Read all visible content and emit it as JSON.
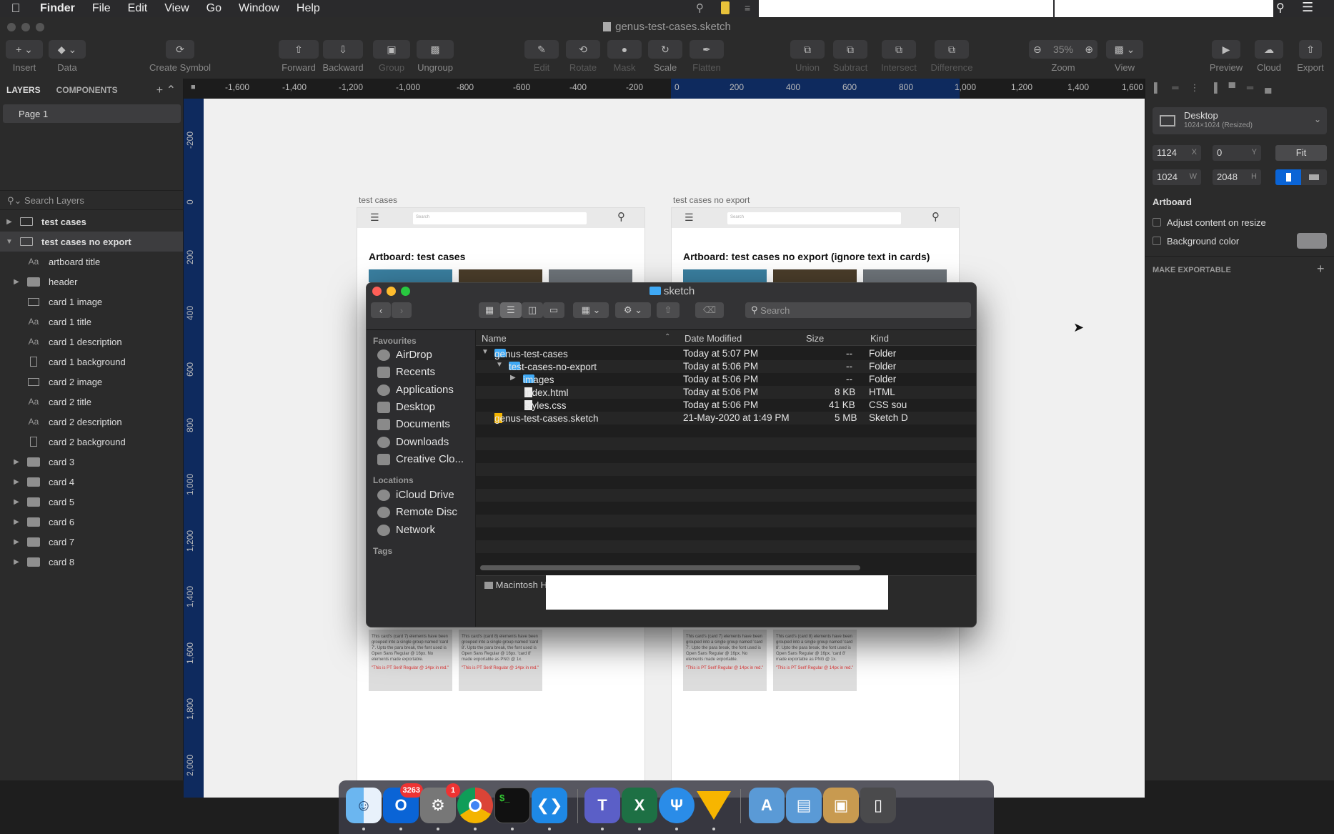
{
  "menubar": {
    "app": "Finder",
    "items": [
      "File",
      "Edit",
      "View",
      "Go",
      "Window",
      "Help"
    ]
  },
  "window": {
    "title": "genus-test-cases.sketch"
  },
  "toolbar": {
    "insert": "Insert",
    "data": "Data",
    "create_symbol": "Create Symbol",
    "forward": "Forward",
    "backward": "Backward",
    "group": "Group",
    "ungroup": "Ungroup",
    "edit": "Edit",
    "rotate": "Rotate",
    "mask": "Mask",
    "scale": "Scale",
    "flatten": "Flatten",
    "union": "Union",
    "subtract": "Subtract",
    "intersect": "Intersect",
    "difference": "Difference",
    "zoom": "Zoom",
    "zoom_value": "35%",
    "view": "View",
    "preview": "Preview",
    "cloud": "Cloud",
    "export": "Export"
  },
  "layers_panel": {
    "tab_layers": "LAYERS",
    "tab_components": "COMPONENTS",
    "page": "Page 1",
    "search_placeholder": "Search Layers",
    "items": [
      {
        "label": "test cases",
        "icon": "artboard-icon"
      },
      {
        "label": "test cases no export",
        "icon": "artboard-icon"
      },
      {
        "label": "artboard title",
        "icon": "text-icon"
      },
      {
        "label": "header",
        "icon": "folder-icon"
      },
      {
        "label": "card 1 image",
        "icon": "rectangle-icon"
      },
      {
        "label": "card 1 title",
        "icon": "text-icon"
      },
      {
        "label": "card 1 description",
        "icon": "text-icon"
      },
      {
        "label": "card 1 background",
        "icon": "rectangle-icon"
      },
      {
        "label": "card 2 image",
        "icon": "rectangle-icon"
      },
      {
        "label": "card 2 title",
        "icon": "text-icon"
      },
      {
        "label": "card 2 description",
        "icon": "text-icon"
      },
      {
        "label": "card 2 background",
        "icon": "rectangle-icon"
      },
      {
        "label": "card 3",
        "icon": "folder-icon"
      },
      {
        "label": "card 4",
        "icon": "folder-icon"
      },
      {
        "label": "card 5",
        "icon": "folder-icon"
      },
      {
        "label": "card 6",
        "icon": "folder-icon"
      },
      {
        "label": "card 7",
        "icon": "folder-icon"
      },
      {
        "label": "card 8",
        "icon": "folder-icon"
      }
    ]
  },
  "ruler": {
    "top": [
      "-1,600",
      "-1,400",
      "-1,200",
      "-1,000",
      "-800",
      "-600",
      "-400",
      "-200",
      "0",
      "200",
      "400",
      "600",
      "800",
      "1,000",
      "1,200",
      "1,400",
      "1,600"
    ],
    "left": [
      "-200",
      "0",
      "200",
      "400",
      "600",
      "800",
      "1,000",
      "1,200",
      "1,400",
      "1,600",
      "1,800",
      "2,000"
    ]
  },
  "canvas": {
    "artboard1_name": "test cases",
    "artboard1_heading": "Artboard: test cases",
    "artboard2_name": "test cases no export",
    "artboard2_heading": "Artboard: test cases no export (ignore text in cards)",
    "search_placeholder": "Search",
    "card7_text": "This card's (card 7) elements have been grouped into a single group named 'card 7'. Upto the para break, the font used is Open Sans Regular @ 16px. No elements made exportable.",
    "card8_text": "This card's (card 8) elements have been grouped into a single group named 'card 8'. Upto the para break, the font used is Open Sans Regular @ 16px. 'card 8' made exportable as PNG @ 1x.",
    "red_text": "\"This is PT Serif Regular @ 14px in red.\""
  },
  "inspector": {
    "preset": "Desktop",
    "preset_size": "1024×1024 (Resized)",
    "x": "1124",
    "x_label": "X",
    "y": "0",
    "y_label": "Y",
    "w": "1024",
    "w_label": "W",
    "h": "2048",
    "h_label": "H",
    "fit": "Fit",
    "section_artboard": "Artboard",
    "adjust_content": "Adjust content on resize",
    "background_color": "Background color",
    "make_exportable": "MAKE EXPORTABLE"
  },
  "finder": {
    "title": "sketch",
    "search_placeholder": "Search",
    "sidebar": {
      "favourites_label": "Favourites",
      "favourites": [
        "AirDrop",
        "Recents",
        "Applications",
        "Desktop",
        "Documents",
        "Downloads",
        "Creative Clo..."
      ],
      "locations_label": "Locations",
      "locations": [
        "iCloud Drive",
        "Remote Disc",
        "Network"
      ],
      "tags_label": "Tags"
    },
    "columns": {
      "name": "Name",
      "date": "Date Modified",
      "size": "Size",
      "kind": "Kind"
    },
    "rows": [
      {
        "name": "genus-test-cases",
        "date": "Today at 5:07 PM",
        "size": "--",
        "kind": "Folder"
      },
      {
        "name": "test-cases-no-export",
        "date": "Today at 5:06 PM",
        "size": "--",
        "kind": "Folder"
      },
      {
        "name": "images",
        "date": "Today at 5:06 PM",
        "size": "--",
        "kind": "Folder"
      },
      {
        "name": "index.html",
        "date": "Today at 5:06 PM",
        "size": "8 KB",
        "kind": "HTML"
      },
      {
        "name": "styles.css",
        "date": "Today at 5:06 PM",
        "size": "41 KB",
        "kind": "CSS sou"
      },
      {
        "name": "genus-test-cases.sketch",
        "date": "21-May-2020 at 1:49 PM",
        "size": "5 MB",
        "kind": "Sketch D"
      }
    ],
    "path": "Macintosh HD"
  },
  "dock": {
    "outlook_badge": "3263",
    "settings_badge": "1",
    "teams_letter": "T",
    "excel_letter": "X"
  },
  "colors": {
    "accent": "#0a64d6",
    "ruler_highlight": "#0e2a5e",
    "folder_blue": "#3fa9f5"
  }
}
